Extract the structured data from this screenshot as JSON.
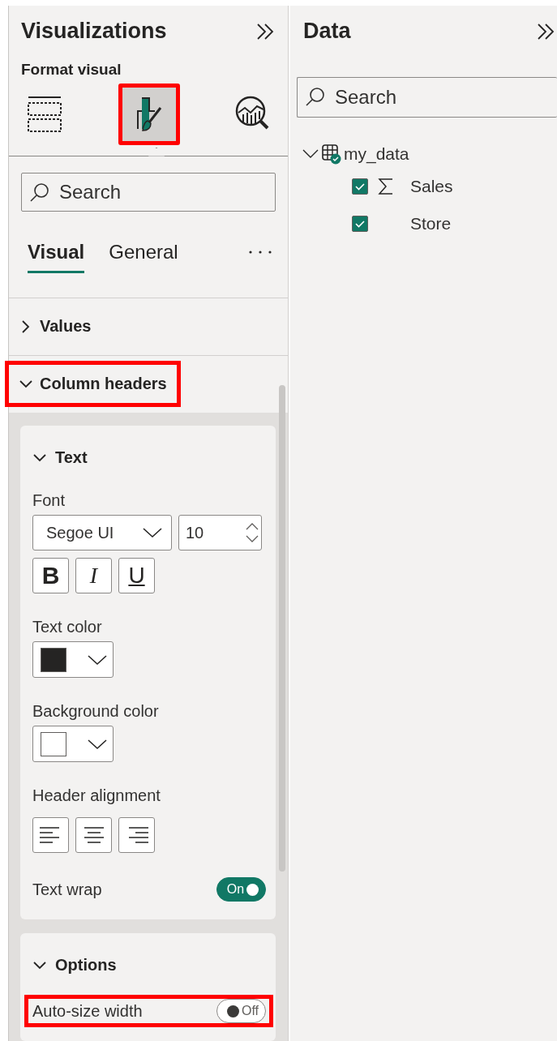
{
  "visualizations": {
    "title": "Visualizations",
    "subtitle": "Format visual",
    "view_icons": [
      {
        "kind": "build",
        "selected": false,
        "highlighted": false
      },
      {
        "kind": "format",
        "selected": true,
        "highlighted": true
      },
      {
        "kind": "analytics",
        "selected": false,
        "highlighted": false
      }
    ],
    "search": {
      "placeholder": "Search"
    },
    "tabs": [
      {
        "label": "Visual",
        "selected": true
      },
      {
        "label": "General",
        "selected": false
      }
    ],
    "sections": [
      {
        "title": "Values",
        "expanded": false,
        "highlighted": false
      },
      {
        "title": "Column headers",
        "expanded": true,
        "highlighted": true
      }
    ],
    "cards": [
      {
        "title": "Text",
        "expanded": true,
        "rows": [
          {
            "kind": "font",
            "label": "Font",
            "font": "Segoe UI",
            "size": "10",
            "styles": [
              {
                "kind": "bold",
                "label": "B"
              },
              {
                "kind": "italic",
                "label": "I"
              },
              {
                "kind": "underline",
                "label": "U"
              }
            ]
          },
          {
            "kind": "color",
            "label": "Text color",
            "color": "#252423"
          },
          {
            "kind": "color",
            "label": "Background color",
            "color": "#ffffff"
          },
          {
            "kind": "alignment",
            "label": "Header alignment",
            "options": [
              {
                "kind": "left"
              },
              {
                "kind": "center"
              },
              {
                "kind": "right"
              }
            ]
          },
          {
            "kind": "toggle",
            "label": "Text wrap",
            "on": true,
            "state_label": "On",
            "highlighted": false
          }
        ]
      },
      {
        "title": "Options",
        "expanded": true,
        "rows": [
          {
            "kind": "toggle",
            "label": "Auto-size width",
            "on": false,
            "state_label": "Off",
            "highlighted": true
          }
        ]
      }
    ]
  },
  "data": {
    "title": "Data",
    "search": {
      "placeholder": "Search"
    },
    "tree": [
      {
        "name": "my_data",
        "expanded": true,
        "children": [
          {
            "name": "Sales",
            "kind": "measure",
            "checked": true
          },
          {
            "name": "Store",
            "kind": "field",
            "checked": true
          }
        ]
      }
    ]
  }
}
